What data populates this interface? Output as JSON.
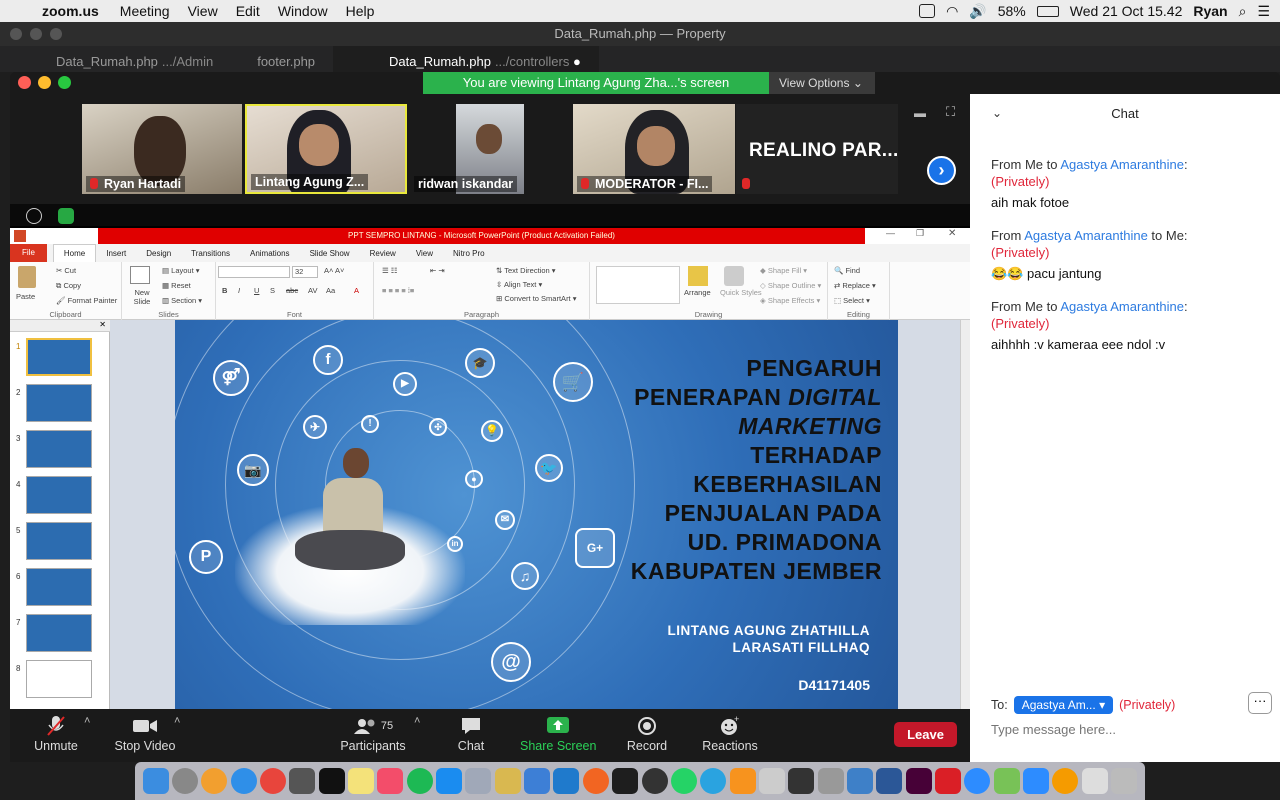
{
  "menubar": {
    "app": "zoom.us",
    "items": [
      "Meeting",
      "View",
      "Edit",
      "Window",
      "Help"
    ],
    "battery": "58%",
    "datetime": "Wed 21 Oct  15.42",
    "user": "Ryan"
  },
  "vscode": {
    "title": "Data_Rumah.php — Property",
    "tabs": [
      {
        "name": "Data_Rumah.php",
        "path": ".../Admin"
      },
      {
        "name": "footer.php",
        "path": ""
      },
      {
        "name": "Data_Rumah.php",
        "path": ".../controllers"
      }
    ]
  },
  "zoom": {
    "banner": "You are viewing Lintang Agung Zha...'s screen",
    "view_options": "View Options",
    "participants": [
      {
        "name": "Ryan Hartadi",
        "muted": true
      },
      {
        "name": "Lintang Agung Z...",
        "muted": false
      },
      {
        "name": "ridwan iskandar",
        "muted": false
      },
      {
        "name": "MODERATOR - FI...",
        "muted": true
      }
    ],
    "name_tile": "REALINO PAR...",
    "toolbar": {
      "unmute": "Unmute",
      "stop_video": "Stop Video",
      "participants": "Participants",
      "participants_count": "75",
      "chat": "Chat",
      "share_screen": "Share Screen",
      "record": "Record",
      "reactions": "Reactions",
      "leave": "Leave"
    }
  },
  "ppt": {
    "window_title": "PPT SEMPRO LINTANG - Microsoft PowerPoint (Product Activation Failed)",
    "tabs": [
      "File",
      "Home",
      "Insert",
      "Design",
      "Transitions",
      "Animations",
      "Slide Show",
      "Review",
      "View",
      "Nitro Pro"
    ],
    "ribbon": {
      "clipboard": {
        "label": "Clipboard",
        "paste": "Paste",
        "cut": "Cut",
        "copy": "Copy",
        "format_painter": "Format Painter"
      },
      "slides": {
        "label": "Slides",
        "new_slide": "New Slide",
        "layout": "Layout",
        "reset": "Reset",
        "section": "Section"
      },
      "font": {
        "label": "Font",
        "size": "32"
      },
      "paragraph": {
        "label": "Paragraph",
        "text_direction": "Text Direction",
        "align_text": "Align Text",
        "smartart": "Convert to SmartArt"
      },
      "drawing": {
        "label": "Drawing",
        "arrange": "Arrange",
        "quick_styles": "Quick Styles",
        "shape_fill": "Shape Fill",
        "shape_outline": "Shape Outline",
        "shape_effects": "Shape Effects"
      },
      "editing": {
        "label": "Editing",
        "find": "Find",
        "replace": "Replace",
        "select": "Select"
      }
    },
    "thumb_numbers": [
      "1",
      "2",
      "3",
      "4",
      "5",
      "6",
      "7",
      "8"
    ],
    "slide": {
      "title_1": "PENGARUH",
      "title_2a": "PENERAPAN ",
      "title_2b": "DIGITAL",
      "title_3": "MARKETING",
      "title_4": "TERHADAP",
      "title_5": "KEBERHASILAN",
      "title_6": "PENJUALAN PADA",
      "title_7": "UD. PRIMADONA",
      "title_8": "KABUPATEN JEMBER",
      "author_1": "LINTANG AGUNG ZHATHILLA",
      "author_2": "LARASATI FILLHAQ",
      "nim": "D41171405"
    }
  },
  "chat": {
    "title": "Chat",
    "messages": [
      {
        "from": "From Me to ",
        "who": "Agastya Amaranthine",
        "tail": ":",
        "private": "(Privately)",
        "text": "aih mak fotoe"
      },
      {
        "from": "From ",
        "who": "Agastya Amaranthine",
        "tail": " to Me:",
        "private": "(Privately)",
        "text": "😂😂  pacu jantung"
      },
      {
        "from": "From Me to ",
        "who": "Agastya Amaranthine",
        "tail": ":",
        "private": "(Privately)",
        "text": "aihhhh :v kameraa eee ndol :v"
      }
    ],
    "to_label": "To:",
    "to_value": "Agastya Am...",
    "to_private": "(Privately)",
    "input_placeholder": "Type message here..."
  },
  "colors": {
    "zoom_green": "#2bb24c",
    "leave_red": "#c4182a",
    "chat_blue": "#2d7be0",
    "private_red": "#e0263a"
  }
}
